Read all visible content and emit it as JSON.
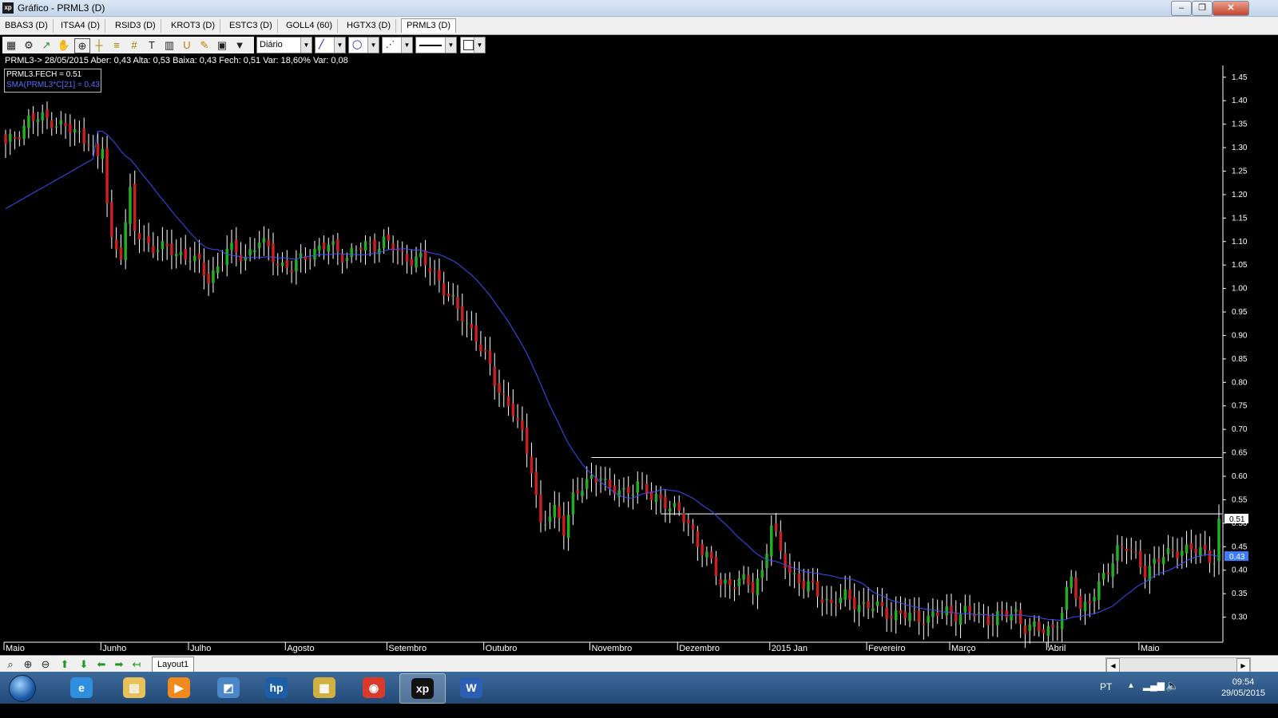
{
  "window": {
    "title": "Gráfico - PRML3 (D)",
    "app_icon_text": "xp",
    "minimize": "‒",
    "maximize": "❐",
    "close": "✕"
  },
  "tabs": [
    {
      "label": "BBAS3 (D)"
    },
    {
      "label": "ITSA4 (D)"
    },
    {
      "label": "RSID3 (D)"
    },
    {
      "label": "KROT3 (D)"
    },
    {
      "label": "ESTC3 (D)"
    },
    {
      "label": "GOLL4 (60)"
    },
    {
      "label": "HGTX3 (D)"
    },
    {
      "label": "PRML3 (D)",
      "active": true
    }
  ],
  "toolbar": {
    "icons": [
      "chart-icon",
      "gear-icon",
      "indicator-icon",
      "hand-icon",
      "zoom-rect-icon",
      "crosshair-icon",
      "fibonacci-icon",
      "grid-icon",
      "text-icon",
      "calculator-icon",
      "magnet-icon",
      "pencil-icon",
      "clipboard-icon",
      "filter-icon"
    ],
    "periodicity": "Diário",
    "line_color": "#000",
    "color_box": "#fff"
  },
  "info": {
    "quote_line": "PRML3-> 28/05/2015 Aber: 0,43 Alta: 0,53 Baixa: 0,43 Fech: 0,51 Var: 18,60% Var: 0,08",
    "legend_close": "PRML3.FECH = 0.51",
    "legend_sma": "SMA(PRML3*C[21] = 0.43"
  },
  "chart_data": {
    "type": "candlestick",
    "symbol": "PRML3",
    "ylim": [
      0.25,
      1.47
    ],
    "y_ticks": [
      0.3,
      0.35,
      0.4,
      0.45,
      0.5,
      0.55,
      0.6,
      0.65,
      0.7,
      0.75,
      0.8,
      0.85,
      0.9,
      0.95,
      1.0,
      1.05,
      1.1,
      1.15,
      1.2,
      1.25,
      1.3,
      1.35,
      1.4,
      1.45
    ],
    "y_tick_labels": [
      "0.30",
      "0.35",
      "0.40",
      "0.45",
      "0.50",
      "0.55",
      "0.60",
      "0.65",
      "0.70",
      "0.75",
      "0.80",
      "0.85",
      "0.90",
      "0.95",
      "1.00",
      "1.05",
      "1.10",
      "1.15",
      "1.20",
      "1.25",
      "1.30",
      "1.35",
      "1.40",
      "1.45"
    ],
    "month_labels": [
      "Maio",
      "Junho",
      "Julho",
      "Agosto",
      "Setembro",
      "Outubro",
      "Novembro",
      "Dezembro",
      "2015 Jan",
      "Fevereiro",
      "Março",
      "Abril",
      "Maio"
    ],
    "month_starts": [
      0,
      21,
      40,
      61,
      83,
      104,
      127,
      146,
      166,
      187,
      205,
      226,
      246
    ],
    "total_bars": 264,
    "horizontal_lines": [
      0.64,
      0.52
    ],
    "last_price": "0.51",
    "last_sma": "0.43",
    "colors": {
      "up": "#22b022",
      "down": "#cc1f1f",
      "sma": "#3d4cff",
      "hline": "#ffffff",
      "wick": "#ffffff"
    },
    "grid": false,
    "close_anchors": [
      [
        0,
        1.3
      ],
      [
        5,
        1.36
      ],
      [
        10,
        1.36
      ],
      [
        15,
        1.33
      ],
      [
        18,
        1.32
      ],
      [
        20,
        1.27
      ],
      [
        21,
        1.3
      ],
      [
        22,
        1.18
      ],
      [
        23,
        1.1
      ],
      [
        25,
        1.08
      ],
      [
        27,
        1.2
      ],
      [
        28,
        1.12
      ],
      [
        30,
        1.1
      ],
      [
        35,
        1.08
      ],
      [
        40,
        1.07
      ],
      [
        44,
        1.02
      ],
      [
        48,
        1.08
      ],
      [
        52,
        1.07
      ],
      [
        55,
        1.1
      ],
      [
        57,
        1.08
      ],
      [
        60,
        1.05
      ],
      [
        62,
        1.04
      ],
      [
        66,
        1.08
      ],
      [
        70,
        1.09
      ],
      [
        74,
        1.07
      ],
      [
        78,
        1.09
      ],
      [
        82,
        1.1
      ],
      [
        86,
        1.07
      ],
      [
        90,
        1.06
      ],
      [
        94,
        1.02
      ],
      [
        98,
        0.95
      ],
      [
        102,
        0.9
      ],
      [
        106,
        0.8
      ],
      [
        110,
        0.74
      ],
      [
        114,
        0.62
      ],
      [
        116,
        0.5
      ],
      [
        119,
        0.52
      ],
      [
        121,
        0.49
      ],
      [
        123,
        0.56
      ],
      [
        126,
        0.58
      ],
      [
        129,
        0.61
      ],
      [
        131,
        0.57
      ],
      [
        134,
        0.56
      ],
      [
        137,
        0.59
      ],
      [
        140,
        0.55
      ],
      [
        143,
        0.55
      ],
      [
        146,
        0.52
      ],
      [
        149,
        0.48
      ],
      [
        152,
        0.43
      ],
      [
        155,
        0.37
      ],
      [
        159,
        0.38
      ],
      [
        162,
        0.36
      ],
      [
        164,
        0.4
      ],
      [
        166,
        0.5
      ],
      [
        168,
        0.43
      ],
      [
        170,
        0.4
      ],
      [
        173,
        0.37
      ],
      [
        176,
        0.35
      ],
      [
        179,
        0.33
      ],
      [
        182,
        0.34
      ],
      [
        185,
        0.33
      ],
      [
        188,
        0.32
      ],
      [
        192,
        0.31
      ],
      [
        196,
        0.3
      ],
      [
        200,
        0.3
      ],
      [
        204,
        0.31
      ],
      [
        208,
        0.31
      ],
      [
        212,
        0.3
      ],
      [
        216,
        0.3
      ],
      [
        219,
        0.31
      ],
      [
        221,
        0.28
      ],
      [
        224,
        0.27
      ],
      [
        227,
        0.28
      ],
      [
        229,
        0.31
      ],
      [
        231,
        0.38
      ],
      [
        233,
        0.32
      ],
      [
        235,
        0.34
      ],
      [
        237,
        0.36
      ],
      [
        239,
        0.4
      ],
      [
        241,
        0.45
      ],
      [
        243,
        0.45
      ],
      [
        245,
        0.42
      ],
      [
        247,
        0.4
      ],
      [
        249,
        0.42
      ],
      [
        252,
        0.43
      ],
      [
        255,
        0.45
      ],
      [
        258,
        0.44
      ],
      [
        261,
        0.43
      ],
      [
        262,
        0.43
      ],
      [
        263,
        0.51
      ]
    ]
  },
  "bottom": {
    "tools": [
      "zoom-icon",
      "zoom-in-icon",
      "zoom-out-icon",
      "arrow-up-icon",
      "arrow-down-icon",
      "arrow-left-icon",
      "arrow-right-icon",
      "arrow-return-icon"
    ],
    "layout_tab": "Layout1"
  },
  "taskbar": {
    "language": "PT",
    "time": "09:54",
    "date": "29/05/2015",
    "apps": [
      {
        "name": "internet-explorer-icon",
        "color": "#2f8fde",
        "glyph": "e"
      },
      {
        "name": "file-explorer-icon",
        "color": "#e8c15a",
        "glyph": "▤"
      },
      {
        "name": "media-player-icon",
        "color": "#f08a1c",
        "glyph": "▶"
      },
      {
        "name": "remote-desktop-icon",
        "color": "#4a86c8",
        "glyph": "◩"
      },
      {
        "name": "hp-icon",
        "color": "#1d5fa6",
        "glyph": "hp"
      },
      {
        "name": "archive-icon",
        "color": "#d0b040",
        "glyph": "▦"
      },
      {
        "name": "chrome-icon",
        "color": "#d93a2b",
        "glyph": "◉"
      },
      {
        "name": "xp-app-icon",
        "color": "#111111",
        "glyph": "xp",
        "active": true
      },
      {
        "name": "word-icon",
        "color": "#2b5fb3",
        "glyph": "W"
      }
    ]
  }
}
